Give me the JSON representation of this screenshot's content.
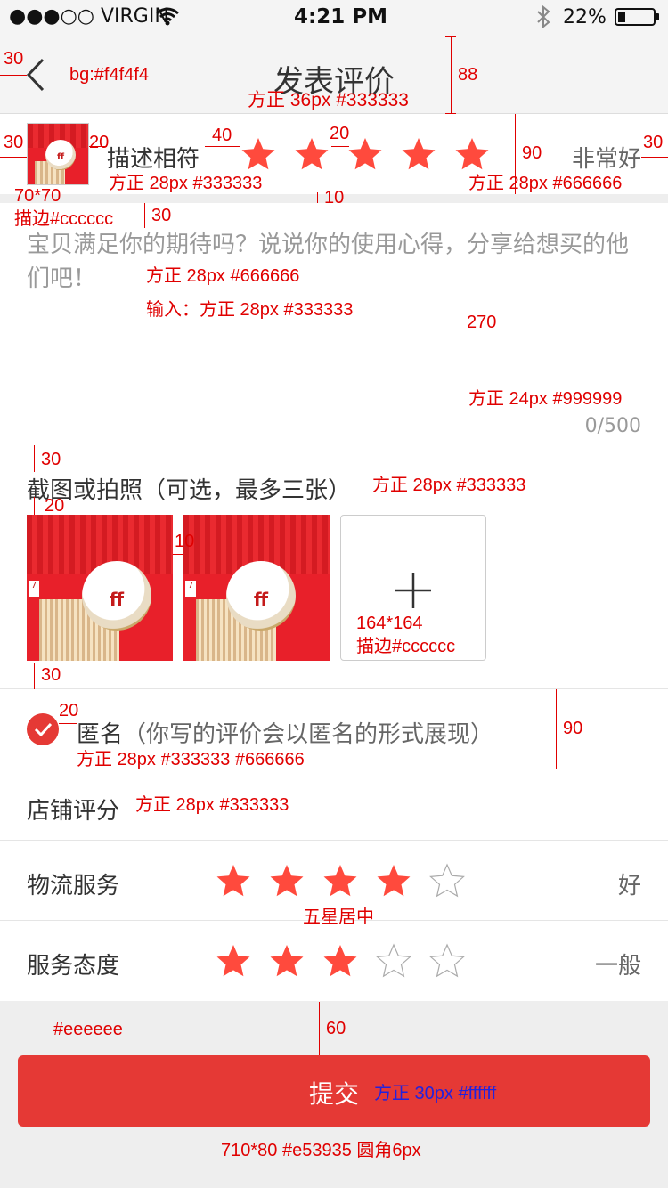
{
  "status_bar": {
    "carrier": "●●●○○ VIRGIN",
    "time": "4:21 PM",
    "battery": "22%",
    "battery_level": 0.22
  },
  "nav": {
    "title": "发表评价",
    "back_icon": "chevron-left-icon"
  },
  "product_row": {
    "label": "描述相符",
    "rating": 5,
    "max": 5,
    "rating_text": "非常好"
  },
  "comment": {
    "placeholder": "宝贝满足你的期待吗？说说你的使用心得，分享给想买的他们吧！",
    "value": "",
    "counter": "0/500"
  },
  "photos": {
    "label": "截图或拍照（可选，最多三张）",
    "count": 2,
    "max": 3,
    "add_icon": "plus-icon"
  },
  "anonymous": {
    "checked": true,
    "label_main": "匿名",
    "label_note": "（你写的评价会以匿名的形式展现）"
  },
  "shop": {
    "title": "店铺评分",
    "rows": [
      {
        "label": "物流服务",
        "rating": 4,
        "max": 5,
        "text": "好"
      },
      {
        "label": "服务态度",
        "rating": 3,
        "max": 5,
        "text": "一般"
      }
    ]
  },
  "submit": {
    "label": "提交"
  },
  "colors": {
    "accent": "#e53935",
    "star": "#ff4a3d",
    "header_bg": "#f4f4f4",
    "page_bg": "#eeeeee",
    "text": "#333333",
    "subtext": "#666666",
    "placeholder": "#999999",
    "border": "#cccccc"
  },
  "annotations": {
    "a1": "30",
    "a2": "bg:#f4f4f4",
    "a3": "方正 36px #333333",
    "a4": "88",
    "a5": "30",
    "a6": "20",
    "a7": "40",
    "a8": "20",
    "a9": "90",
    "a10": "30",
    "a11": "方正 28px #333333",
    "a12": "方正 28px #666666",
    "a13": "70*70",
    "a14": "描边#cccccc",
    "a15": "10",
    "a16": "30",
    "a17": "方正 28px #666666",
    "a18": "输入：方正 28px #333333",
    "a19": "270",
    "a20": "方正 24px #999999",
    "a21": "30",
    "a22": "方正 28px #333333",
    "a23": "20",
    "a24": "10",
    "a25": "164*164",
    "a26": "描边#cccccc",
    "a27": "30",
    "a28": "20",
    "a29": "90",
    "a30": "方正 28px #333333 #666666",
    "a31": "方正 28px #333333",
    "a32": "五星居中",
    "a33": "#eeeeee",
    "a34": "60",
    "a35": "方正 30px #ffffff",
    "a36": "710*80 #e53935 圆角6px"
  }
}
